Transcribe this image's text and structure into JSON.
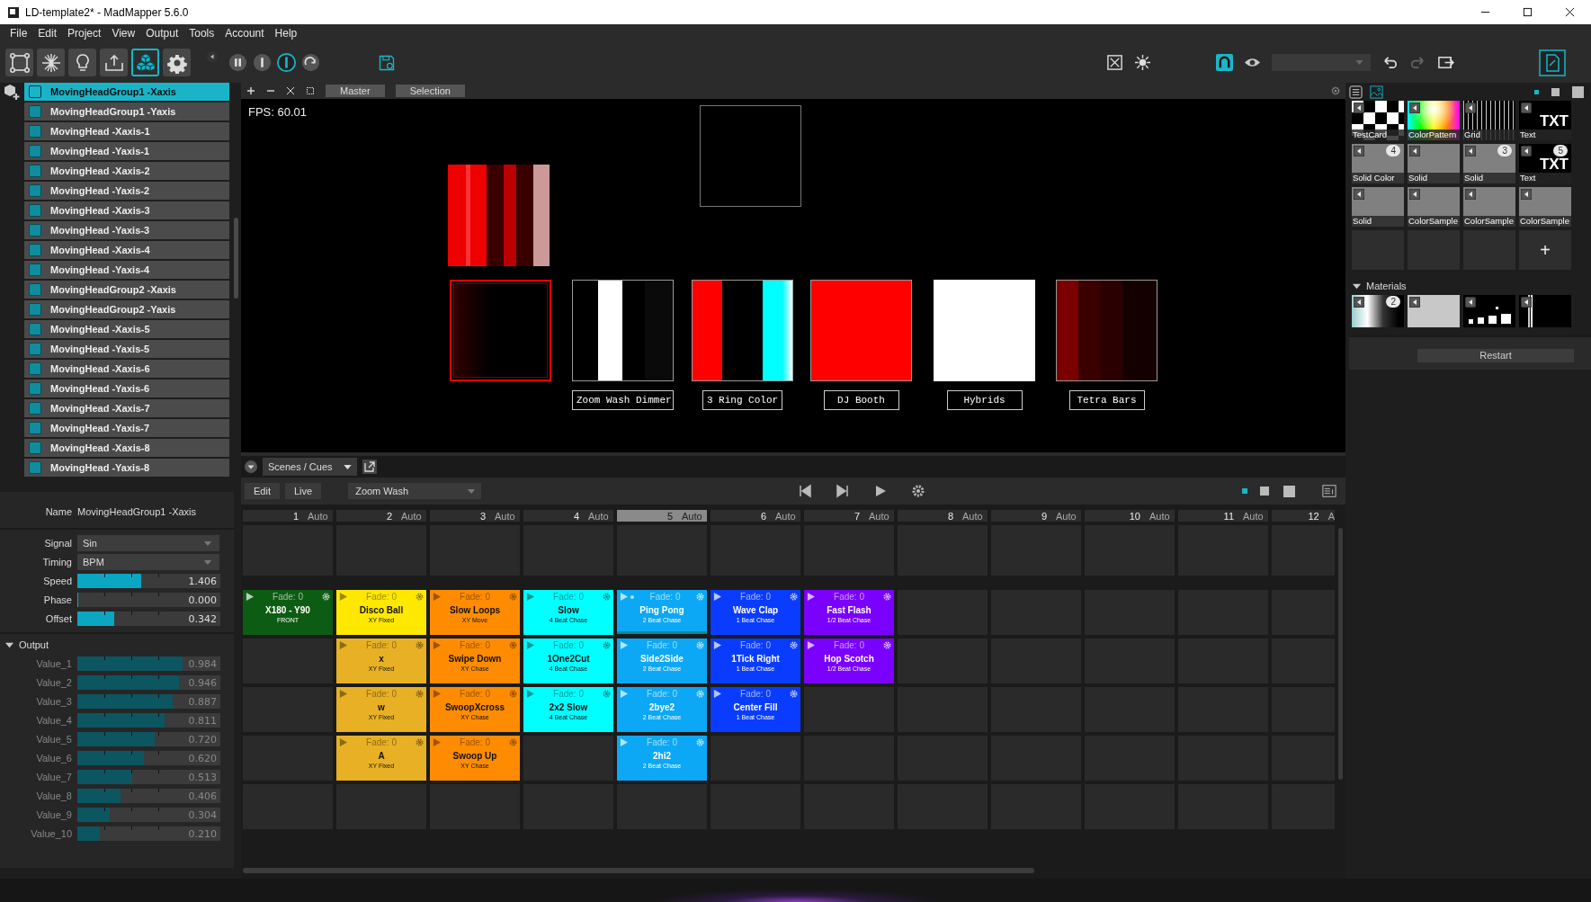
{
  "window": {
    "title": "LD-template2* - MadMapper 5.6.0"
  },
  "menu": [
    "File",
    "Edit",
    "Project",
    "View",
    "Output",
    "Tools",
    "Account",
    "Help"
  ],
  "tools": [
    {
      "kind": "surfaces",
      "selected": false
    },
    {
      "kind": "laser",
      "selected": false
    },
    {
      "kind": "bulb",
      "selected": false
    },
    {
      "kind": "output",
      "selected": false
    },
    {
      "kind": "cubes",
      "selected": true
    },
    {
      "kind": "gear",
      "selected": false
    }
  ],
  "transport": [
    {
      "kind": "pause",
      "selected": false
    },
    {
      "kind": "bar",
      "selected": false
    },
    {
      "kind": "ring",
      "selected": true
    },
    {
      "kind": "loop",
      "selected": false
    }
  ],
  "view_tabs": [
    {
      "label": "Master"
    },
    {
      "label": "Selection"
    }
  ],
  "layers": [
    {
      "label": "MovingHeadGroup1 -Xaxis",
      "selected": true
    },
    {
      "label": "MovingHeadGroup1 -Yaxis",
      "selected": false
    },
    {
      "label": "MovingHead -Xaxis-1",
      "selected": false
    },
    {
      "label": "MovingHead -Yaxis-1",
      "selected": false
    },
    {
      "label": "MovingHead -Xaxis-2",
      "selected": false
    },
    {
      "label": "MovingHead -Yaxis-2",
      "selected": false
    },
    {
      "label": "MovingHead -Xaxis-3",
      "selected": false
    },
    {
      "label": "MovingHead -Yaxis-3",
      "selected": false
    },
    {
      "label": "MovingHead -Xaxis-4",
      "selected": false
    },
    {
      "label": "MovingHead -Yaxis-4",
      "selected": false
    },
    {
      "label": "MovingHeadGroup2 -Xaxis",
      "selected": false
    },
    {
      "label": "MovingHeadGroup2 -Yaxis",
      "selected": false
    },
    {
      "label": "MovingHead -Xaxis-5",
      "selected": false
    },
    {
      "label": "MovingHead -Yaxis-5",
      "selected": false
    },
    {
      "label": "MovingHead -Xaxis-6",
      "selected": false
    },
    {
      "label": "MovingHead -Yaxis-6",
      "selected": false
    },
    {
      "label": "MovingHead -Xaxis-7",
      "selected": false
    },
    {
      "label": "MovingHead -Yaxis-7",
      "selected": false
    },
    {
      "label": "MovingHead -Xaxis-8",
      "selected": false
    },
    {
      "label": "MovingHead -Yaxis-8",
      "selected": false
    }
  ],
  "properties": {
    "name_label": "Name",
    "name": "MovingHeadGroup1 -Xaxis",
    "params": [
      {
        "kind": "dropdown",
        "label": "Signal",
        "value": "Sin"
      },
      {
        "kind": "dropdown",
        "label": "Timing",
        "value": "BPM"
      },
      {
        "kind": "slider",
        "label": "Speed",
        "level": 0.595,
        "reading": "1.406"
      },
      {
        "kind": "slider",
        "label": "Phase",
        "level": 0,
        "reading": "0.000"
      },
      {
        "kind": "slider",
        "label": "Offset",
        "level": 0.342,
        "reading": "0.342"
      }
    ],
    "output": {
      "label": "Output",
      "expanded": true,
      "values": [
        {
          "label": "Value_1",
          "level": 0.984,
          "reading": "0.984"
        },
        {
          "label": "Value_2",
          "level": 0.946,
          "reading": "0.946"
        },
        {
          "label": "Value_3",
          "level": 0.887,
          "reading": "0.887"
        },
        {
          "label": "Value_4",
          "level": 0.811,
          "reading": "0.811"
        },
        {
          "label": "Value_5",
          "level": 0.72,
          "reading": "0.720"
        },
        {
          "label": "Value_6",
          "level": 0.62,
          "reading": "0.620"
        },
        {
          "label": "Value_7",
          "level": 0.513,
          "reading": "0.513"
        },
        {
          "label": "Value_8",
          "level": 0.406,
          "reading": "0.406"
        },
        {
          "label": "Value_9",
          "level": 0.304,
          "reading": "0.304"
        },
        {
          "label": "Value_10",
          "level": 0.21,
          "reading": "0.210"
        }
      ]
    }
  },
  "viewport": {
    "fps": "FPS: 60.01",
    "fixture_labels": [
      "Zoom Wash Dimmer",
      "3 Ring Color",
      "DJ Booth",
      "Hybrids",
      "Tetra Bars"
    ]
  },
  "scenes": {
    "tab": "Scenes / Cues",
    "edit": "Edit",
    "live": "Live",
    "scene": "Zoom Wash",
    "columns": [
      {
        "number": "1",
        "mode": "Auto",
        "selected": false,
        "cues": [
          {
            "fade": "Fade: 0",
            "title": "X180 - Y90",
            "subtitle": "FRONT",
            "color": "#0d5c13",
            "playing": false
          }
        ]
      },
      {
        "number": "2",
        "mode": "Auto",
        "selected": false,
        "cues": [
          {
            "fade": "Fade: 0",
            "title": "Disco Ball",
            "subtitle": "XY Fixed",
            "color": "#ffe800",
            "playing": false
          },
          {
            "fade": "Fade: 0",
            "title": "x",
            "subtitle": "XY Fixed",
            "color": "#e8b125",
            "playing": false
          },
          {
            "fade": "Fade: 0",
            "title": "w",
            "subtitle": "XY Fixed",
            "color": "#e8b125",
            "playing": false
          },
          {
            "fade": "Fade: 0",
            "title": "A",
            "subtitle": "XY Fixed",
            "color": "#e8b125",
            "playing": false
          }
        ]
      },
      {
        "number": "3",
        "mode": "Auto",
        "selected": false,
        "cues": [
          {
            "fade": "Fade: 0",
            "title": "Slow Loops",
            "subtitle": "XY Move",
            "color": "#ff8c00",
            "playing": false
          },
          {
            "fade": "Fade: 0",
            "title": "Swipe Down",
            "subtitle": "XY Chase",
            "color": "#ff8c00",
            "playing": false
          },
          {
            "fade": "Fade: 0",
            "title": "SwoopXcross",
            "subtitle": "XY Chase",
            "color": "#ff8c00",
            "playing": false
          },
          {
            "fade": "Fade: 0",
            "title": "Swoop Up",
            "subtitle": "XY Chase",
            "color": "#ff8c00",
            "playing": false
          }
        ]
      },
      {
        "number": "4",
        "mode": "Auto",
        "selected": false,
        "cues": [
          {
            "fade": "Fade: 0",
            "title": "Slow",
            "subtitle": "4 Beat Chase",
            "color": "#00ffff",
            "playing": false
          },
          {
            "fade": "Fade: 0",
            "title": "1One2Cut",
            "subtitle": "4 Beat Chase",
            "color": "#00ffff",
            "playing": false
          },
          {
            "fade": "Fade: 0",
            "title": "2x2 Slow",
            "subtitle": "4 Beat Chase",
            "color": "#00ffff",
            "playing": false
          }
        ]
      },
      {
        "number": "5",
        "mode": "Auto",
        "selected": true,
        "cues": [
          {
            "fade": "Fade: 0",
            "title": "Ping Pong",
            "subtitle": "2 Beat Chase",
            "color": "#0ca8f5",
            "playing": true
          },
          {
            "fade": "Fade: 0",
            "title": "Side2Side",
            "subtitle": "2 Beat Chase",
            "color": "#0ca8f5",
            "playing": false
          },
          {
            "fade": "Fade: 0",
            "title": "2bye2",
            "subtitle": "2 Beat Chase",
            "color": "#0ca8f5",
            "playing": false
          },
          {
            "fade": "Fade: 0",
            "title": "2hi2",
            "subtitle": "2 Beat Chase",
            "color": "#0ca8f5",
            "playing": false
          }
        ]
      },
      {
        "number": "6",
        "mode": "Auto",
        "selected": false,
        "cues": [
          {
            "fade": "Fade: 0",
            "title": "Wave Clap",
            "subtitle": "1 Beat Chase",
            "color": "#0a3cff",
            "playing": false
          },
          {
            "fade": "Fade: 0",
            "title": "1Tick Right",
            "subtitle": "1 Beat Chase",
            "color": "#0a3cff",
            "playing": false
          },
          {
            "fade": "Fade: 0",
            "title": "Center Fill",
            "subtitle": "1 Beat Chase",
            "color": "#0a3cff",
            "playing": false
          }
        ]
      },
      {
        "number": "7",
        "mode": "Auto",
        "selected": false,
        "cues": [
          {
            "fade": "Fade: 0",
            "title": "Fast Flash",
            "subtitle": "1/2 Beat Chase",
            "color": "#7a00ff",
            "playing": false
          },
          {
            "fade": "Fade: 0",
            "title": "Hop Scotch",
            "subtitle": "1/2 Beat Chase",
            "color": "#7a00ff",
            "playing": false
          }
        ]
      },
      {
        "number": "8",
        "mode": "Auto",
        "selected": false
      },
      {
        "number": "9",
        "mode": "Auto",
        "selected": false
      },
      {
        "number": "10",
        "mode": "Auto",
        "selected": false
      },
      {
        "number": "11",
        "mode": "Auto",
        "selected": false
      },
      {
        "number": "12",
        "mode": "A",
        "selected": false
      }
    ]
  },
  "media": {
    "items": [
      {
        "kind": "testcard",
        "label": "TestCard"
      },
      {
        "kind": "colorpattern",
        "label": "ColorPattern"
      },
      {
        "kind": "grid",
        "label": "Grid"
      },
      {
        "kind": "text",
        "label": "Text",
        "preview": "TXT"
      },
      {
        "kind": "solid",
        "label": "Solid Color",
        "badge": "4"
      },
      {
        "kind": "solid",
        "label": "Solid"
      },
      {
        "kind": "solid",
        "label": "Solid",
        "badge": "3"
      },
      {
        "kind": "text",
        "label": "Text",
        "preview": "TXT",
        "badge": "5"
      },
      {
        "kind": "solid",
        "label": "Solid"
      },
      {
        "kind": "solid",
        "label": "ColorSample"
      },
      {
        "kind": "solid",
        "label": "ColorSample"
      },
      {
        "kind": "solid",
        "label": "ColorSample"
      }
    ],
    "add": "+",
    "materials_label": "Materials",
    "materials_expanded": true,
    "materials": [
      {
        "kind": "gradient",
        "badge": "2"
      },
      {
        "kind": "strobe"
      },
      {
        "kind": "shapes"
      },
      {
        "kind": "line"
      }
    ],
    "restart": "Restart"
  }
}
